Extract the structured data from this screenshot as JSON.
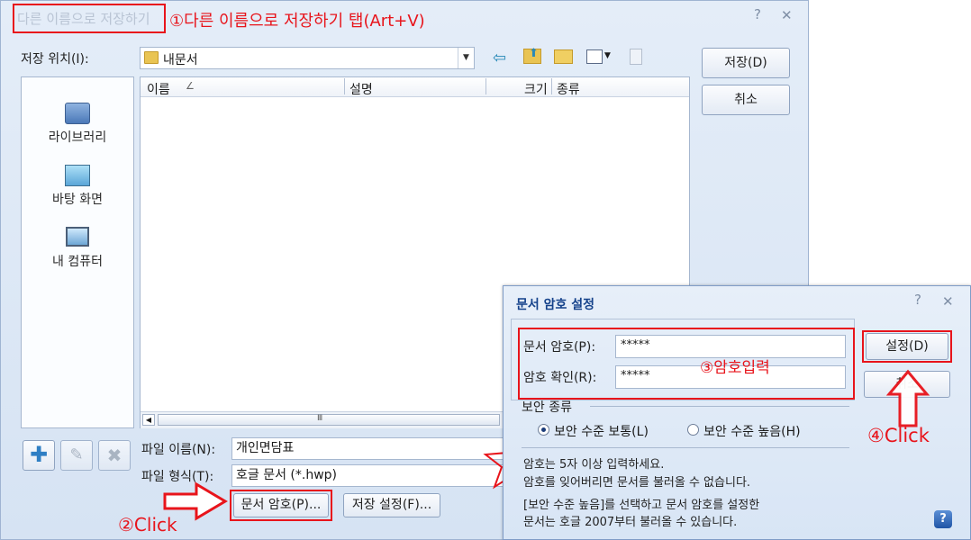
{
  "window": {
    "title": "다른 이름으로 저장하기",
    "help": "?",
    "close": "✕"
  },
  "annotations": {
    "step1": "①다른 이름으로 저장하기 탭(Art+V)",
    "step2": "②Click",
    "step3": "③암호입력",
    "step4": "④Click"
  },
  "location": {
    "label": "저장 위치(I):",
    "value": "내문서"
  },
  "actions": {
    "save": "저장(D)",
    "cancel": "취소"
  },
  "places": [
    {
      "label": "라이브러리",
      "icon": "library-icon"
    },
    {
      "label": "바탕 화면",
      "icon": "desktop-icon"
    },
    {
      "label": "내 컴퓨터",
      "icon": "computer-icon"
    }
  ],
  "columns": [
    "이름",
    "설명",
    "크기",
    "종류"
  ],
  "file_name": {
    "label": "파일 이름(N):",
    "value": "개인면담표"
  },
  "file_type": {
    "label": "파일 형식(T):",
    "value": "호글 문서 (*.hwp)"
  },
  "bottom_buttons": {
    "password": "문서 암호(P)...",
    "save_settings": "저장 설정(F)..."
  },
  "password_dialog": {
    "title": "문서 암호 설정",
    "help": "?",
    "close": "✕",
    "password_label": "문서 암호(P):",
    "password_value": "*****",
    "confirm_label": "암호 확인(R):",
    "confirm_value": "*****",
    "ok": "설정(D)",
    "cancel": "취소",
    "security_group": "보안 종류",
    "option_normal": "보안 수준 보통(L)",
    "option_high": "보안 수준 높음(H)",
    "selected_option": "normal",
    "info1": "암호는 5자 이상 입력하세요.",
    "info2": "암호를 잊어버리면 문서를 불러올 수 없습니다.",
    "info3": "[보안 수준 높음]를 선택하고 문서 암호를 설정한",
    "info4": "문서는 호글 2007부터 불러올 수 있습니다."
  },
  "colors": {
    "annotation_red": "#e8141b",
    "dialog_bg": "#dbe6f4",
    "button_border": "#8fa3c0"
  }
}
